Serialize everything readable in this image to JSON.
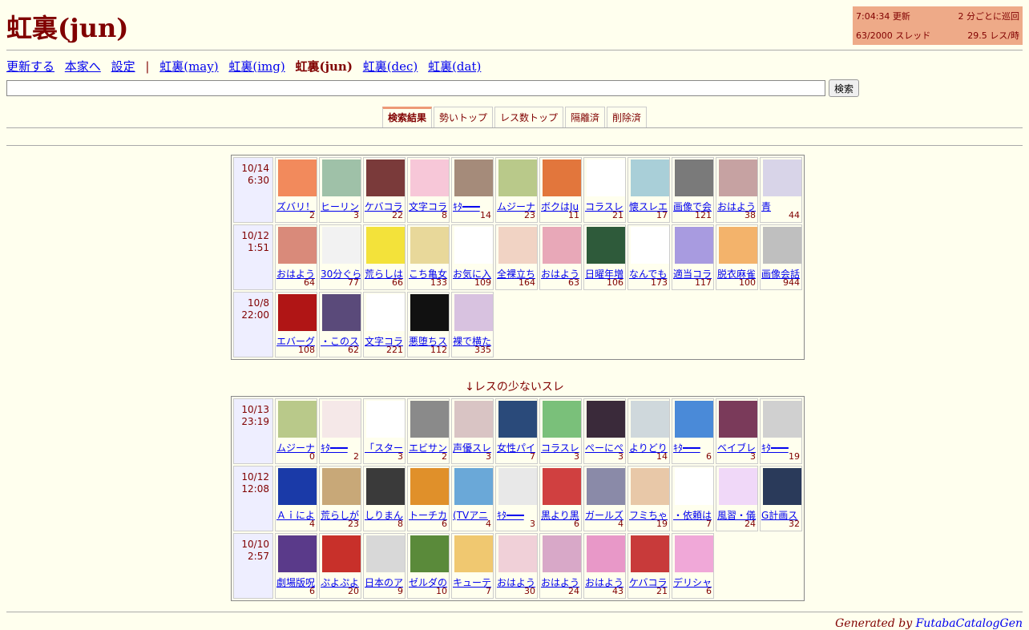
{
  "header": {
    "title": "虹裏(jun)"
  },
  "stats": {
    "time": "7:04:34 更新",
    "interval": "2 分ごとに巡回",
    "threads": "63/2000 スレッド",
    "rate": "29.5 レス/時"
  },
  "nav": {
    "refresh": "更新する",
    "home": "本家へ",
    "settings": "設定",
    "sep": "|",
    "may": "虹裏(may)",
    "img": "虹裏(img)",
    "jun": "虹裏(jun)",
    "dec": "虹裏(dec)",
    "dat": "虹裏(dat)"
  },
  "search": {
    "button": "検索",
    "value": ""
  },
  "tabs": [
    "検索結果",
    "勢いトップ",
    "レス数トップ",
    "隔離済",
    "削除済"
  ],
  "sections": {
    "few_title": "↓レスの少ないスレ"
  },
  "catalog_main": [
    {
      "date": "10/14",
      "time": "6:30",
      "cells": [
        {
          "title": "ズバリ！",
          "count": "2",
          "color": "#f28a5c"
        },
        {
          "title": "ヒーリン",
          "count": "3",
          "color": "#9fc1a8"
        },
        {
          "title": "ケバコラ",
          "count": "22",
          "color": "#7a3a3a"
        },
        {
          "title": "文字コラ",
          "count": "8",
          "color": "#f7c7d8"
        },
        {
          "title": "ｷﾀ━━━",
          "count": "14",
          "color": "#a58b7a"
        },
        {
          "title": "ムジーナ",
          "count": "23",
          "color": "#b9c98a"
        },
        {
          "title": "ボクはJu",
          "count": "11",
          "color": "#e2763c"
        },
        {
          "title": "コラスレ",
          "count": "21",
          "color": "#ffffff"
        },
        {
          "title": "懐スレエ",
          "count": "17",
          "color": "#a9cfd8"
        },
        {
          "title": "画像で会",
          "count": "121",
          "color": "#7a7a7a"
        },
        {
          "title": "おはよう",
          "count": "38",
          "color": "#c6a2a2"
        },
        {
          "title": "青",
          "count": "44",
          "color": "#d8d4e8"
        }
      ]
    },
    {
      "date": "10/12",
      "time": "1:51",
      "cells": [
        {
          "title": "おはよう",
          "count": "64",
          "color": "#d98a7a"
        },
        {
          "title": "30分ぐら",
          "count": "77",
          "color": "#f2f2f2"
        },
        {
          "title": "荒らしは",
          "count": "66",
          "color": "#f3e23a"
        },
        {
          "title": "こち亀女",
          "count": "133",
          "color": "#e8d89a"
        },
        {
          "title": "お気に入",
          "count": "109",
          "color": "#ffffff"
        },
        {
          "title": "全裸立ち",
          "count": "164",
          "color": "#f1d3c4"
        },
        {
          "title": "おはよう",
          "count": "63",
          "color": "#e8a8b8"
        },
        {
          "title": "日曜年増",
          "count": "106",
          "color": "#2e5a3a"
        },
        {
          "title": "なんでも",
          "count": "173",
          "color": "#ffffff"
        },
        {
          "title": "適当コラ",
          "count": "117",
          "color": "#a89be0"
        },
        {
          "title": "脱衣麻雀",
          "count": "100",
          "color": "#f3b36b"
        },
        {
          "title": "画像会話",
          "count": "944",
          "color": "#bfbfbf"
        }
      ]
    },
    {
      "date": "10/8",
      "time": "22:00",
      "cells": [
        {
          "title": "エバーグ",
          "count": "108",
          "color": "#b01515"
        },
        {
          "title": "・このス",
          "count": "62",
          "color": "#5a4a7a"
        },
        {
          "title": "文字コラ",
          "count": "221",
          "color": "#ffffff"
        },
        {
          "title": "悪堕ちス",
          "count": "112",
          "color": "#111111"
        },
        {
          "title": "裸で横た",
          "count": "335",
          "color": "#d8c2e0"
        }
      ]
    }
  ],
  "catalog_few": [
    {
      "date": "10/13",
      "time": "23:19",
      "cells": [
        {
          "title": "ムジーナ",
          "count": "0",
          "color": "#b9c98a"
        },
        {
          "title": "ｷﾀ━━━",
          "count": "2",
          "color": "#f5e8e8"
        },
        {
          "title": "「スター",
          "count": "3",
          "color": "#ffffff"
        },
        {
          "title": "エビサン",
          "count": "2",
          "color": "#8a8a8a"
        },
        {
          "title": "声優スレ",
          "count": "3",
          "color": "#d9c4c4"
        },
        {
          "title": "女性パイ",
          "count": "7",
          "color": "#2a4a7a"
        },
        {
          "title": "コラスレ",
          "count": "3",
          "color": "#7ac07a"
        },
        {
          "title": "ぺーにぺ",
          "count": "3",
          "color": "#3a2a3a"
        },
        {
          "title": "よりどり",
          "count": "14",
          "color": "#cfd8dc"
        },
        {
          "title": "ｷﾀ━━━",
          "count": "6",
          "color": "#4a8ad8"
        },
        {
          "title": "ベイブレ",
          "count": "3",
          "color": "#7a3a5a"
        },
        {
          "title": "ｷﾀ━━━",
          "count": "19",
          "color": "#d0d0d0"
        }
      ]
    },
    {
      "date": "10/12",
      "time": "12:08",
      "cells": [
        {
          "title": "Ａｉによ",
          "count": "4",
          "color": "#1a3aa8"
        },
        {
          "title": "荒らしが",
          "count": "23",
          "color": "#c8a878"
        },
        {
          "title": "しりまん",
          "count": "8",
          "color": "#3a3a3a"
        },
        {
          "title": "トーチカ",
          "count": "6",
          "color": "#e0902a"
        },
        {
          "title": "(TVアニ",
          "count": "4",
          "color": "#6aa8d8"
        },
        {
          "title": "ｷﾀ━━━",
          "count": "3",
          "color": "#e8e8e8"
        },
        {
          "title": "黒より黒",
          "count": "6",
          "color": "#d04040"
        },
        {
          "title": "ガールズ",
          "count": "4",
          "color": "#8a8aa8"
        },
        {
          "title": "フミちゃ",
          "count": "19",
          "color": "#e8c8a8"
        },
        {
          "title": "・依頼は",
          "count": "7",
          "color": "#ffffff"
        },
        {
          "title": "風習・儀",
          "count": "24",
          "color": "#f0d8f8"
        },
        {
          "title": "G計画ス",
          "count": "32",
          "color": "#2a3a5a"
        }
      ]
    },
    {
      "date": "10/10",
      "time": "2:57",
      "cells": [
        {
          "title": "劇場版呪",
          "count": "6",
          "color": "#5a3a8a"
        },
        {
          "title": "ぷよぷよ",
          "count": "20",
          "color": "#c8302a"
        },
        {
          "title": "日本のア",
          "count": "9",
          "color": "#d8d8d8"
        },
        {
          "title": "ゼルダの",
          "count": "10",
          "color": "#5a8a3a"
        },
        {
          "title": "キューテ",
          "count": "7",
          "color": "#f0c870"
        },
        {
          "title": "おはよう",
          "count": "30",
          "color": "#f0d0d8"
        },
        {
          "title": "おはよう",
          "count": "24",
          "color": "#d8a8c8"
        },
        {
          "title": "おはよう",
          "count": "43",
          "color": "#e898c8"
        },
        {
          "title": "ケバコラ",
          "count": "21",
          "color": "#c83a3a"
        },
        {
          "title": "デリシャ",
          "count": "6",
          "color": "#f0a8d8"
        }
      ]
    }
  ],
  "footer": {
    "prefix": "Generated by ",
    "link": "FutabaCatalogGen"
  }
}
